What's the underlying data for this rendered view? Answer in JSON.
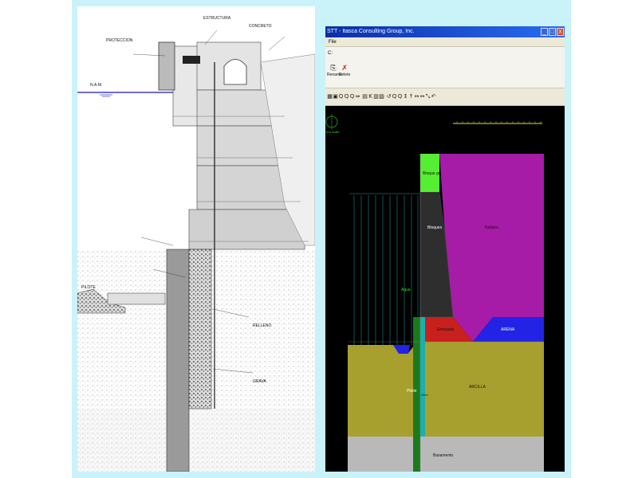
{
  "drawing": {
    "annotations": [
      "ESTRUCTURA",
      "PROTECCION",
      "CONCRETO",
      "RELLENO",
      "GRAVA",
      "N.A.M.",
      "PILOTE"
    ]
  },
  "app": {
    "title": "STT - Itasca Consulting Group, Inc.",
    "menu": "File",
    "subbar": "C:",
    "buttons": [
      {
        "label": "Rename",
        "icon": "⎘"
      },
      {
        "label": "Delete",
        "icon": "✗"
      }
    ],
    "window_controls": [
      "_",
      "□",
      "X"
    ],
    "toolbar_icons": [
      "▦",
      "▣",
      "Q",
      "Q",
      "Q",
      "⇔",
      "▤",
      "K",
      "▥",
      "▨",
      "↺",
      "Q",
      "Q",
      "↕",
      "↑",
      "↔",
      "↔",
      "⤡",
      "↶"
    ],
    "scale_label": "(m) scale",
    "zones": [
      {
        "name": "Relleno",
        "color": "#a61ca6"
      },
      {
        "name": "Bloques",
        "color": "#2e2e2e"
      },
      {
        "name": "Bloque gr",
        "color": "#55ee33"
      },
      {
        "name": "Enrocado",
        "color": "#c8201c"
      },
      {
        "name": "ARENA",
        "color": "#2323e6"
      },
      {
        "name": "ARCILLA",
        "color": "#a8a02e"
      },
      {
        "name": "Pilote",
        "color": "#1c7a1c"
      },
      {
        "name": "Dren",
        "color": "#1ab0b0"
      },
      {
        "name": "Basamento",
        "color": "#b9b9b9"
      },
      {
        "name": "Agua",
        "color": "#000000"
      }
    ]
  },
  "colors": {
    "frame": "#c9f3f8",
    "titlebar": "#0a2ea8",
    "canvas": "#000000"
  }
}
